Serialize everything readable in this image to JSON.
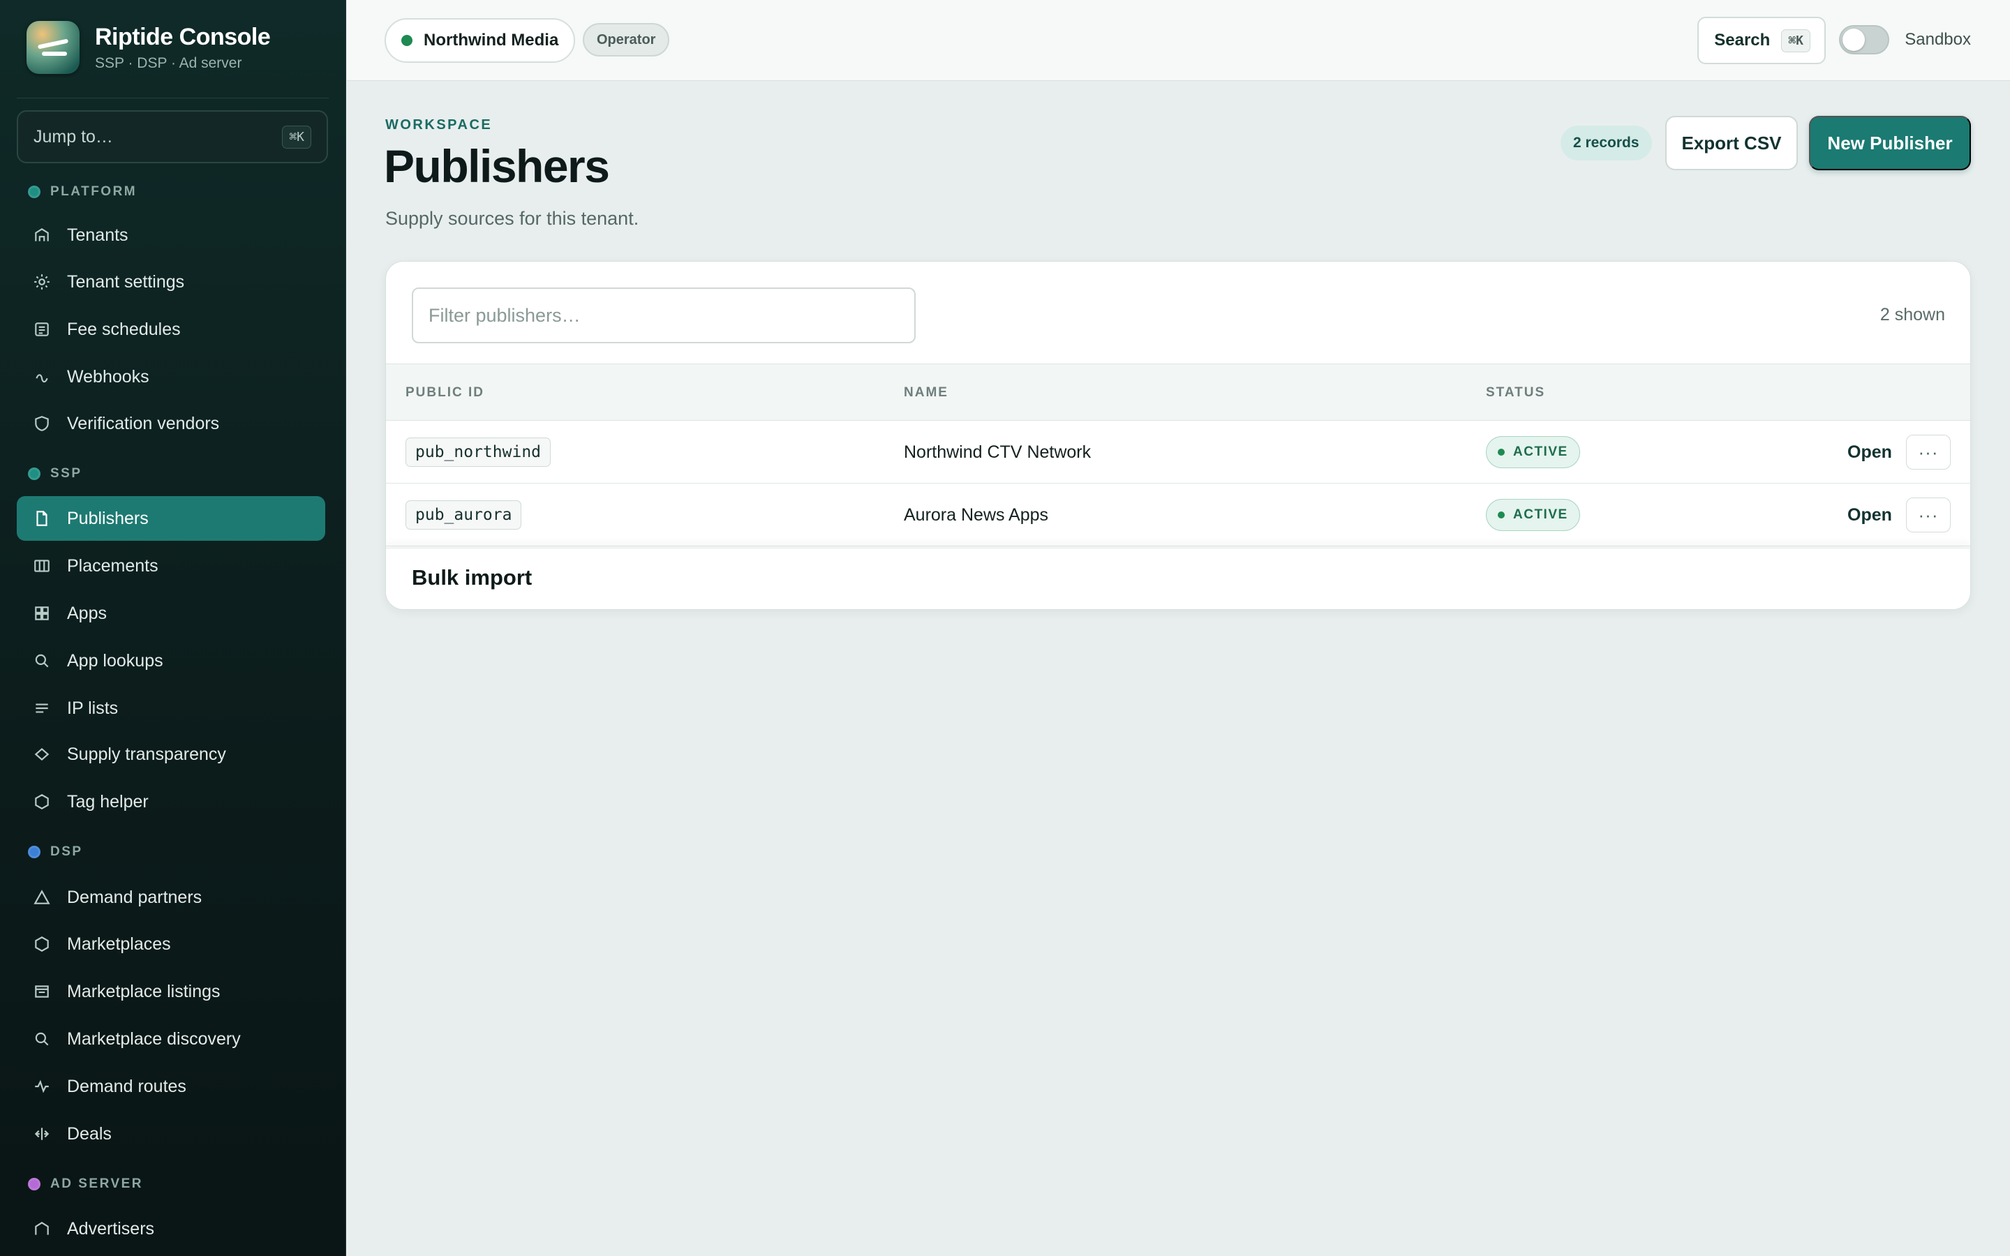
{
  "brand": {
    "title": "Riptide Console",
    "subtitle": "SSP · DSP · Ad server"
  },
  "sidebar": {
    "jump": {
      "label": "Jump to…",
      "shortcut": "⌘K"
    },
    "sections": [
      {
        "label": "PLATFORM",
        "dot_color": "#1f8f84"
      },
      {
        "label": "SSP",
        "dot_color": "#1f8f84"
      },
      {
        "label": "DSP",
        "dot_color": "#3c7fd6"
      },
      {
        "label": "AD SERVER",
        "dot_color": "#b56ad6"
      }
    ],
    "items": [
      {
        "label": "Tenants",
        "icon": "building-icon"
      },
      {
        "label": "Tenant settings",
        "icon": "gear-icon"
      },
      {
        "label": "Fee schedules",
        "icon": "receipt-icon"
      },
      {
        "label": "Webhooks",
        "icon": "webhook-icon"
      },
      {
        "label": "Verification vendors",
        "icon": "shield-icon"
      },
      {
        "label": "Publishers",
        "icon": "document-icon",
        "active": true
      },
      {
        "label": "Placements",
        "icon": "columns-icon"
      },
      {
        "label": "Apps",
        "icon": "grid-icon"
      },
      {
        "label": "App lookups",
        "icon": "search-icon"
      },
      {
        "label": "IP lists",
        "icon": "list-icon"
      },
      {
        "label": "Supply transparency",
        "icon": "diamond-icon"
      },
      {
        "label": "Tag helper",
        "icon": "hexagon-icon"
      },
      {
        "label": "Demand partners",
        "icon": "triangle-icon"
      },
      {
        "label": "Marketplaces",
        "icon": "hexagon-icon"
      },
      {
        "label": "Marketplace listings",
        "icon": "listing-icon"
      },
      {
        "label": "Marketplace discovery",
        "icon": "search-icon"
      },
      {
        "label": "Demand routes",
        "icon": "pulse-icon"
      },
      {
        "label": "Deals",
        "icon": "handshake-icon"
      },
      {
        "label": "Advertisers",
        "icon": "building-icon"
      }
    ]
  },
  "topbar": {
    "tenant": "Northwind Media",
    "role": "Operator",
    "search_label": "Search",
    "search_shortcut": "⌘K",
    "sandbox_label": "Sandbox",
    "sandbox_on": false
  },
  "header": {
    "eyebrow": "WORKSPACE",
    "title": "Publishers",
    "description": "Supply sources for this tenant.",
    "records_badge": "2 records",
    "export_label": "Export CSV",
    "new_label": "New Publisher"
  },
  "table": {
    "filter_placeholder": "Filter publishers…",
    "shown_count": "2 shown",
    "columns": [
      "PUBLIC ID",
      "NAME",
      "STATUS"
    ],
    "rows": [
      {
        "public_id": "pub_northwind",
        "name": "Northwind CTV Network",
        "status": "ACTIVE",
        "action": "Open"
      },
      {
        "public_id": "pub_aurora",
        "name": "Aurora News Apps",
        "status": "ACTIVE",
        "action": "Open"
      }
    ],
    "more_label": "···"
  },
  "bulk": {
    "title": "Bulk import"
  },
  "colors": {
    "accent": "#1b7a72",
    "sidebar_bg": "#0f2a28",
    "active_status": "#1f8a52"
  }
}
